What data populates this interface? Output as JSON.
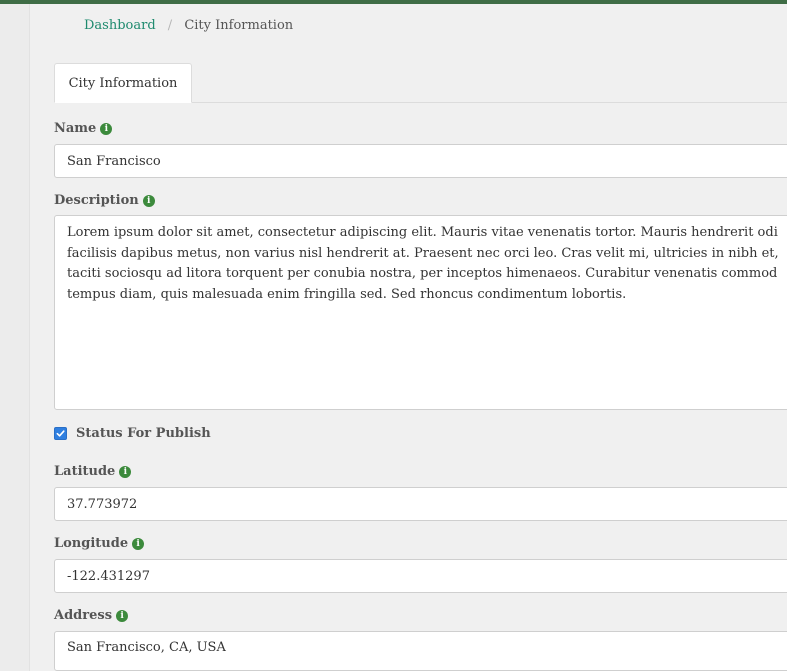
{
  "breadcrumb": {
    "home": "Dashboard",
    "separator": "/",
    "current": "City Information"
  },
  "tabs": [
    {
      "label": "City Information",
      "active": true
    }
  ],
  "form": {
    "name": {
      "label": "Name",
      "value": "San Francisco"
    },
    "description": {
      "label": "Description",
      "lines": [
        "Lorem ipsum dolor sit amet, consectetur adipiscing elit. Mauris vitae venenatis tortor. Mauris hendrerit odi",
        "facilisis dapibus metus, non varius nisl hendrerit at. Praesent nec orci leo. Cras velit mi, ultricies in nibh et,",
        "taciti sociosqu ad litora torquent per conubia nostra, per inceptos himenaeos. Curabitur venenatis commod",
        "tempus diam, quis malesuada enim fringilla sed. Sed rhoncus condimentum lobortis."
      ]
    },
    "status": {
      "label": "Status For Publish",
      "checked": true
    },
    "latitude": {
      "label": "Latitude",
      "value": "37.773972"
    },
    "longitude": {
      "label": "Longitude",
      "value": "-122.431297"
    },
    "address": {
      "label": "Address",
      "value": "San Francisco, CA, USA"
    }
  },
  "icons": {
    "info": "info-icon",
    "check": "check-icon"
  },
  "colors": {
    "accent_bar": "#3f6d46",
    "link": "#1e8a6e",
    "info_icon": "#3c8a3c",
    "checkbox": "#2f7fe0"
  }
}
